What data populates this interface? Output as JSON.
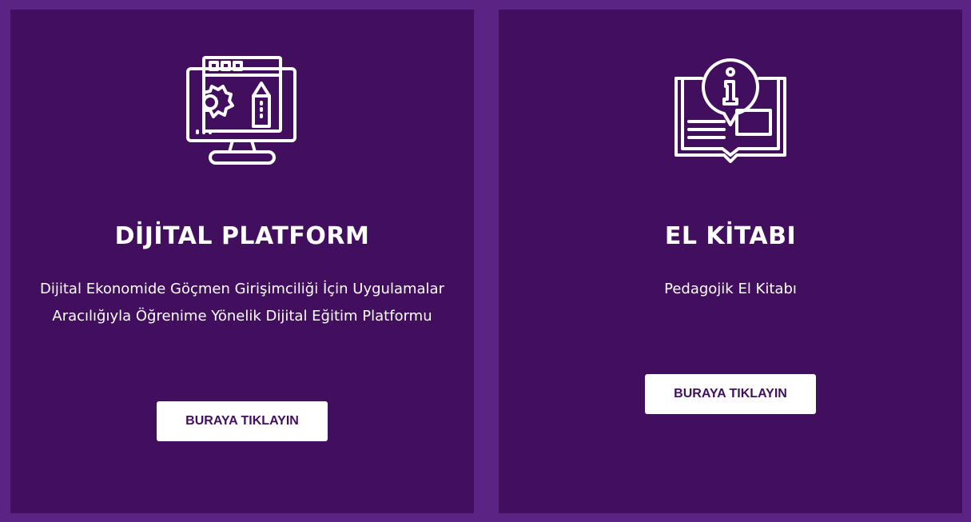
{
  "colors": {
    "frame": "#5b2383",
    "card": "#420e5e",
    "button_bg": "#ffffff",
    "button_text": "#420e5e"
  },
  "cards": [
    {
      "icon": "computer-design-icon",
      "title": "DİJİTAL PLATFORM",
      "description": "Dijital Ekonomide Göçmen Girişimciliği İçin Uygulamalar Aracılığıyla Öğrenime Yönelik Dijital Eğitim Platformu",
      "button_label": "BURAYA TIKLAYIN"
    },
    {
      "icon": "info-book-icon",
      "title": "EL KİTABI",
      "description": "Pedagojik El Kitabı",
      "button_label": "BURAYA TIKLAYIN"
    }
  ]
}
